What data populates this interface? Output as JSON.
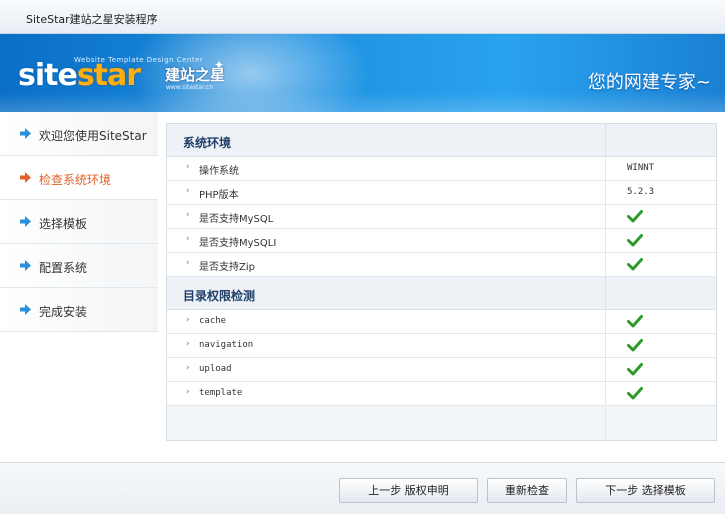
{
  "window": {
    "title": "SiteStar建站之星安装程序"
  },
  "banner": {
    "logo_word_a": "site",
    "logo_word_b": "star",
    "logo_cn": "建站之星",
    "logo_sub": "Website Template Design Center",
    "logo_url": "www.sitestar.cn",
    "slogan": "您的网建专家~"
  },
  "sidebar": {
    "items": [
      {
        "label": "欢迎您使用SiteStar",
        "active": false
      },
      {
        "label": "检查系统环境",
        "active": true
      },
      {
        "label": "选择模板",
        "active": false
      },
      {
        "label": "配置系统",
        "active": false
      },
      {
        "label": "完成安装",
        "active": false
      }
    ]
  },
  "system_env": {
    "header": "系统环境",
    "rows": [
      {
        "name": "操作系统",
        "value": "WINNT",
        "ok": null
      },
      {
        "name": "PHP版本",
        "value": "5.2.3",
        "ok": null
      },
      {
        "name": "是否支持MySQL",
        "value": "",
        "ok": true
      },
      {
        "name": "是否支持MySQLI",
        "value": "",
        "ok": true
      },
      {
        "name": "是否支持Zip",
        "value": "",
        "ok": true
      }
    ]
  },
  "dir_perm": {
    "header": "目录权限检测",
    "rows": [
      {
        "name": "cache",
        "ok": true
      },
      {
        "name": "navigation",
        "ok": true
      },
      {
        "name": "upload",
        "ok": true
      },
      {
        "name": "template",
        "ok": true
      }
    ]
  },
  "footer": {
    "prev_label": "上一步 版权申明",
    "recheck_label": "重新检查",
    "next_label": "下一步 选择模板"
  },
  "colors": {
    "active_nav": "#e0622b",
    "arrow": "#2a8fdc",
    "check": "#2e9a2e",
    "header_text": "#1f3f6a"
  }
}
